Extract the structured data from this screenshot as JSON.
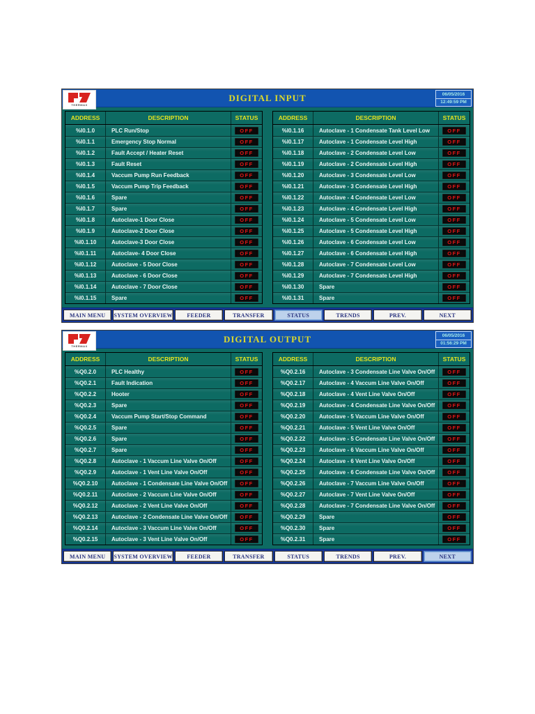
{
  "logo": {
    "text": "THERMAX"
  },
  "colors": {
    "header_blue": "#1254b0",
    "body_teal": "#0d6b63",
    "label_yellow": "#e6e31f",
    "status_red": "#e41616",
    "status_bg": "#0b0b0b",
    "nav_blue": "#16389b"
  },
  "panels": [
    {
      "title": "DIGITAL INPUT",
      "date": "06/05/2016",
      "time": "12:49:59 PM",
      "columns": {
        "address": "ADDRESS",
        "description": "DESCRIPTION",
        "status": "STATUS"
      },
      "left_rows": [
        {
          "address": "%I0.1.0",
          "description": "PLC Run/Stop",
          "status": "OFF"
        },
        {
          "address": "%I0.1.1",
          "description": "Emergency Stop Normal",
          "status": "OFF"
        },
        {
          "address": "%I0.1.2",
          "description": "Fault Accept / Heater Reset",
          "status": "OFF"
        },
        {
          "address": "%I0.1.3",
          "description": "Fault Reset",
          "status": "OFF"
        },
        {
          "address": "%I0.1.4",
          "description": "Vaccum Pump Run Feedback",
          "status": "OFF"
        },
        {
          "address": "%I0.1.5",
          "description": "Vaccum Pump Trip Feedback",
          "status": "OFF"
        },
        {
          "address": "%I0.1.6",
          "description": "Spare",
          "status": "OFF"
        },
        {
          "address": "%I0.1.7",
          "description": "Spare",
          "status": "OFF"
        },
        {
          "address": "%I0.1.8",
          "description": "Autoclave-1 Door Close",
          "status": "OFF"
        },
        {
          "address": "%I0.1.9",
          "description": "Autoclave-2 Door Close",
          "status": "OFF"
        },
        {
          "address": "%I0.1.10",
          "description": "Autoclave-3 Door Close",
          "status": "OFF"
        },
        {
          "address": "%I0.1.11",
          "description": "Autoclave- 4 Door Close",
          "status": "OFF"
        },
        {
          "address": "%I0.1.12",
          "description": "Autoclave - 5 Door Close",
          "status": "OFF"
        },
        {
          "address": "%I0.1.13",
          "description": "Autoclave - 6 Door Close",
          "status": "OFF"
        },
        {
          "address": "%I0.1.14",
          "description": "Autoclave - 7 Door Close",
          "status": "OFF"
        },
        {
          "address": "%I0.1.15",
          "description": "Spare",
          "status": "OFF"
        }
      ],
      "right_rows": [
        {
          "address": "%I0.1.16",
          "description": "Autoclave - 1 Condensate Tank Level Low",
          "status": "OFF"
        },
        {
          "address": "%I0.1.17",
          "description": "Autoclave - 1 Condensate Level High",
          "status": "OFF"
        },
        {
          "address": "%I0.1.18",
          "description": "Autoclave - 2 Condensate Level Low",
          "status": "OFF"
        },
        {
          "address": "%I0.1.19",
          "description": "Autoclave - 2 Condensate Level High",
          "status": "OFF"
        },
        {
          "address": "%I0.1.20",
          "description": "Autoclave - 3 Condensate Level Low",
          "status": "OFF"
        },
        {
          "address": "%I0.1.21",
          "description": "Autoclave - 3 Condensate Level High",
          "status": "OFF"
        },
        {
          "address": "%I0.1.22",
          "description": "Autoclave - 4 Condensate Level Low",
          "status": "OFF"
        },
        {
          "address": "%I0.1.23",
          "description": "Autoclave - 4 Condensate Level High",
          "status": "OFF"
        },
        {
          "address": "%I0.1.24",
          "description": "Autoclave - 5 Condensate Level Low",
          "status": "OFF"
        },
        {
          "address": "%I0.1.25",
          "description": "Autoclave - 5 Condensate Level High",
          "status": "OFF"
        },
        {
          "address": "%I0.1.26",
          "description": "Autoclave - 6 Condensate Level Low",
          "status": "OFF"
        },
        {
          "address": "%I0.1.27",
          "description": "Autoclave - 6 Condensate Level High",
          "status": "OFF"
        },
        {
          "address": "%I0.1.28",
          "description": "Autoclave - 7 Condensate Level Low",
          "status": "OFF"
        },
        {
          "address": "%I0.1.29",
          "description": "Autoclave - 7 Condensate Level High",
          "status": "OFF"
        },
        {
          "address": "%I0.1.30",
          "description": "Spare",
          "status": "OFF"
        },
        {
          "address": "%I0.1.31",
          "description": "Spare",
          "status": "OFF"
        }
      ],
      "nav": [
        "MAIN MENU",
        "SYSTEM OVERVIEW",
        "FEEDER",
        "TRANSFER",
        "STATUS",
        "TRENDS",
        "PREV.",
        "NEXT"
      ],
      "active_nav": "STATUS"
    },
    {
      "title": "DIGITAL OUTPUT",
      "date": "06/05/2016",
      "time": "01:56:29 PM",
      "columns": {
        "address": "ADDRESS",
        "description": "DESCRIPTION",
        "status": "STATUS"
      },
      "left_rows": [
        {
          "address": "%Q0.2.0",
          "description": "PLC Healthy",
          "status": "OFF"
        },
        {
          "address": "%Q0.2.1",
          "description": "Fault Indication",
          "status": "OFF"
        },
        {
          "address": "%Q0.2.2",
          "description": "Hooter",
          "status": "OFF"
        },
        {
          "address": "%Q0.2.3",
          "description": "Spare",
          "status": "OFF"
        },
        {
          "address": "%Q0.2.4",
          "description": "Vaccum Pump Start/Stop Command",
          "status": "OFF"
        },
        {
          "address": "%Q0.2.5",
          "description": "Spare",
          "status": "OFF"
        },
        {
          "address": "%Q0.2.6",
          "description": "Spare",
          "status": "OFF"
        },
        {
          "address": "%Q0.2.7",
          "description": "Spare",
          "status": "OFF"
        },
        {
          "address": "%Q0.2.8",
          "description": "Autoclave - 1 Vaccum Line Valve On/Off",
          "status": "OFF"
        },
        {
          "address": "%Q0.2.9",
          "description": "Autoclave - 1 Vent Line Valve On/Off",
          "status": "OFF"
        },
        {
          "address": "%Q0.2.10",
          "description": "Autoclave - 1 Condensate Line Valve On/Off",
          "status": "OFF"
        },
        {
          "address": "%Q0.2.11",
          "description": "Autoclave - 2 Vaccum Line Valve On/Off",
          "status": "OFF"
        },
        {
          "address": "%Q0.2.12",
          "description": "Autoclave - 2 Vent Line Valve On/Off",
          "status": "OFF"
        },
        {
          "address": "%Q0.2.13",
          "description": "Autoclave - 2 Condensate Line Valve On/Off",
          "status": "OFF"
        },
        {
          "address": "%Q0.2.14",
          "description": "Autoclave - 3 Vaccum Line Valve On/Off",
          "status": "OFF"
        },
        {
          "address": "%Q0.2.15",
          "description": "Autoclave - 3 Vent Line Valve On/Off",
          "status": "OFF"
        }
      ],
      "right_rows": [
        {
          "address": "%Q0.2.16",
          "description": "Autoclave - 3 Condensate Line Valve On/Off",
          "status": "OFF"
        },
        {
          "address": "%Q0.2.17",
          "description": "Autoclave - 4 Vaccum Line Valve On/Off",
          "status": "OFF"
        },
        {
          "address": "%Q0.2.18",
          "description": "Autoclave - 4 Vent Line Valve On/Off",
          "status": "OFF"
        },
        {
          "address": "%Q0.2.19",
          "description": "Autoclave - 4 Condensate Line Valve On/Off",
          "status": "OFF"
        },
        {
          "address": "%Q0.2.20",
          "description": "Autoclave - 5 Vaccum Line Valve On/Off",
          "status": "OFF"
        },
        {
          "address": "%Q0.2.21",
          "description": "Autoclave - 5 Vent Line Valve On/Off",
          "status": "OFF"
        },
        {
          "address": "%Q0.2.22",
          "description": "Autoclave - 5 Condensate Line Valve On/Off",
          "status": "OFF"
        },
        {
          "address": "%Q0.2.23",
          "description": "Autoclave - 6 Vaccum Line Valve On/Off",
          "status": "OFF"
        },
        {
          "address": "%Q0.2.24",
          "description": "Autoclave - 6 Vent Line Valve On/Off",
          "status": "OFF"
        },
        {
          "address": "%Q0.2.25",
          "description": "Autoclave - 6 Condensate Line Valve On/Off",
          "status": "OFF"
        },
        {
          "address": "%Q0.2.26",
          "description": "Autoclave - 7 Vaccum Line Valve On/Off",
          "status": "OFF"
        },
        {
          "address": "%Q0.2.27",
          "description": "Autoclave - 7 Vent Line Valve On/Off",
          "status": "OFF"
        },
        {
          "address": "%Q0.2.28",
          "description": "Autoclave - 7 Condensate Line Valve On/Off",
          "status": "OFF"
        },
        {
          "address": "%Q0.2.29",
          "description": "Spare",
          "status": "OFF"
        },
        {
          "address": "%Q0.2.30",
          "description": "Spare",
          "status": "OFF"
        },
        {
          "address": "%Q0.2.31",
          "description": "Spare",
          "status": "OFF"
        }
      ],
      "nav": [
        "MAIN MENU",
        "SYSTEM OVERVIEW",
        "FEEDER",
        "TRANSFER",
        "STATUS",
        "TRENDS",
        "PREV.",
        "NEXT"
      ],
      "active_nav": "NEXT"
    }
  ]
}
